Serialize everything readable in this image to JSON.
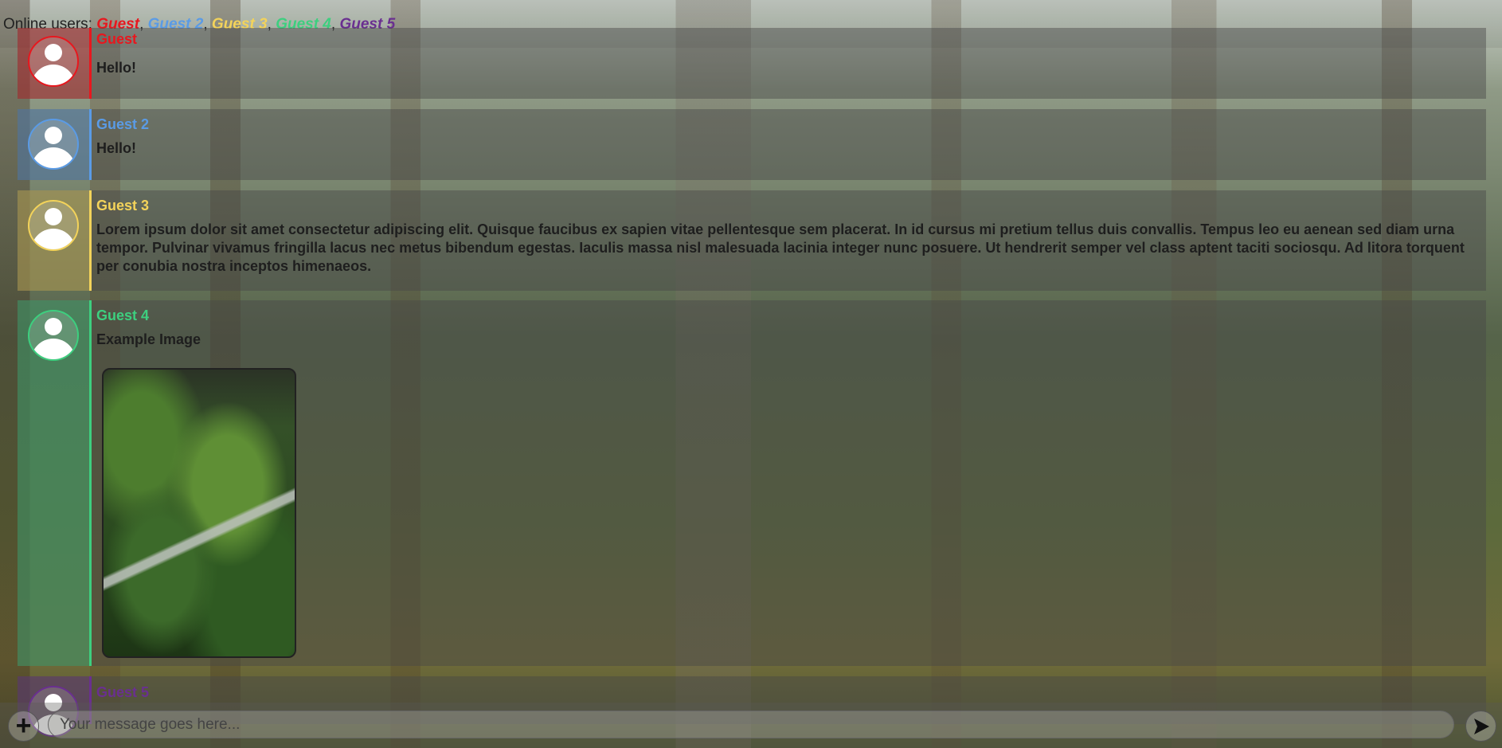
{
  "header": {
    "online_label": "Online users:",
    "users": [
      {
        "name": "Guest",
        "color": "#e8171e"
      },
      {
        "name": "Guest 2",
        "color": "#5a9be6"
      },
      {
        "name": "Guest 3",
        "color": "#f3d35a"
      },
      {
        "name": "Guest 4",
        "color": "#3dcf7f"
      },
      {
        "name": "Guest 5",
        "color": "#6a2f90"
      }
    ]
  },
  "messages": [
    {
      "author": "Guest",
      "color": "#e8171e",
      "text": "Hello!"
    },
    {
      "author": "Guest 2",
      "color": "#5a9be6",
      "text": "Hello!"
    },
    {
      "author": "Guest 3",
      "color": "#f3d35a",
      "text": "Lorem ipsum dolor sit amet consectetur adipiscing elit. Quisque faucibus ex sapien vitae pellentesque sem placerat. In id cursus mi pretium tellus duis convallis. Tempus leo eu aenean sed diam urna tempor. Pulvinar vivamus fringilla lacus nec metus bibendum egestas. Iaculis massa nisl malesuada lacinia integer nunc posuere. Ut hendrerit semper vel class aptent taciti sociosqu. Ad litora torquent per conubia nostra inceptos himenaeos."
    },
    {
      "author": "Guest 4",
      "color": "#3dcf7f",
      "text": "Example Image",
      "attachment_icon": "forest-photo"
    },
    {
      "author": "Guest 5",
      "color": "#6a2f90",
      "text": ""
    }
  ],
  "composer": {
    "placeholder": "Your message goes here...",
    "attach_icon": "plus-icon",
    "send_icon": "send-arrow-icon"
  }
}
